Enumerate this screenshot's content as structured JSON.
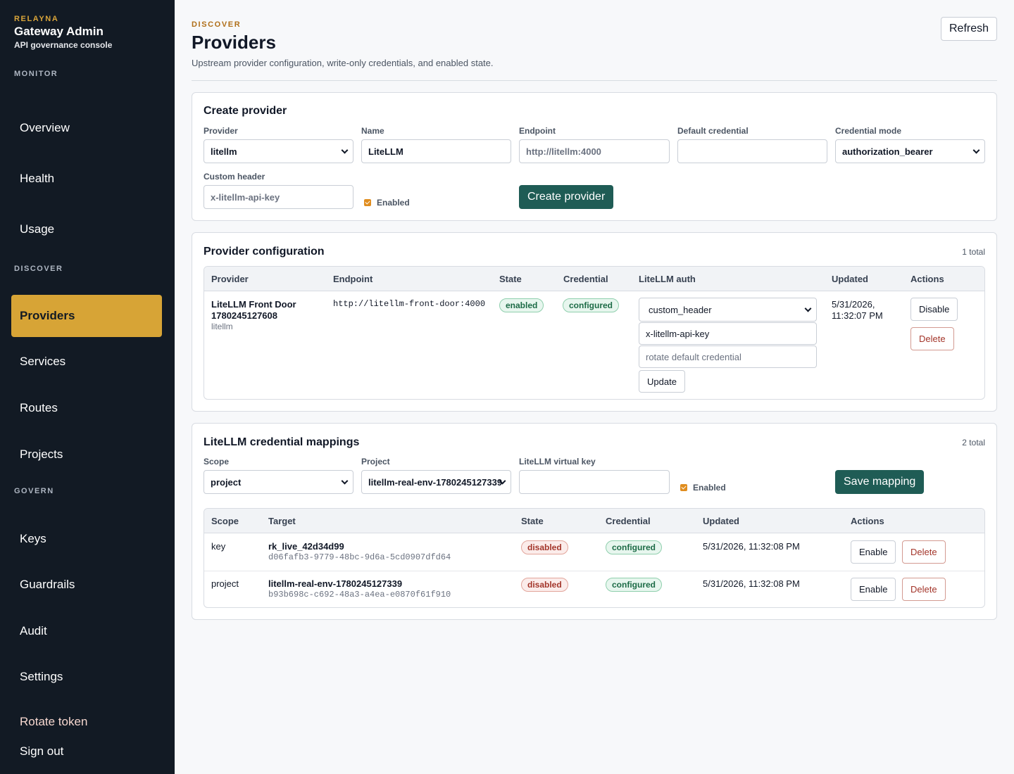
{
  "sidebar": {
    "brand": {
      "kicker": "RELAYNA",
      "title": "Gateway Admin",
      "subtitle": "API governance console"
    },
    "sections": {
      "monitor": "MONITOR",
      "discover": "DISCOVER",
      "govern": "GOVERN"
    },
    "items": {
      "overview": "Overview",
      "health": "Health",
      "usage": "Usage",
      "providers": "Providers",
      "services": "Services",
      "routes": "Routes",
      "projects": "Projects",
      "keys": "Keys",
      "guardrails": "Guardrails",
      "audit": "Audit",
      "settings": "Settings"
    },
    "active": "providers",
    "rotate_token": "Rotate token",
    "sign_out": "Sign out"
  },
  "header": {
    "kicker": "DISCOVER",
    "title": "Providers",
    "description": "Upstream provider configuration, write-only credentials, and enabled state.",
    "refresh_label": "Refresh"
  },
  "create": {
    "title": "Create provider",
    "labels": {
      "provider": "Provider",
      "name": "Name",
      "endpoint": "Endpoint",
      "default_credential": "Default credential",
      "credential_mode": "Credential mode",
      "custom_header": "Custom header"
    },
    "values": {
      "provider": "litellm",
      "name": "LiteLLM",
      "default_credential": "",
      "credential_mode": "authorization_bearer"
    },
    "placeholders": {
      "endpoint": "http://litellm:4000",
      "custom_header": "x-litellm-api-key"
    },
    "enabled_label": "Enabled",
    "enabled": true,
    "submit_label": "Create provider"
  },
  "config": {
    "title": "Provider configuration",
    "count": "1 total",
    "headers": {
      "provider": "Provider",
      "endpoint": "Endpoint",
      "state": "State",
      "credential": "Credential",
      "auth": "LiteLLM auth",
      "updated": "Updated",
      "actions": "Actions"
    },
    "row": {
      "name_line1": "LiteLLM Front Door",
      "name_line2": "1780245127608",
      "kind": "litellm",
      "endpoint": "http://litellm-front-door:4000",
      "state": "enabled",
      "credential": "configured",
      "auth_mode": "custom_header",
      "auth_header": "x-litellm-api-key",
      "rotate_placeholder": "rotate default credential",
      "update_label": "Update",
      "updated_line1": "5/31/2026,",
      "updated_line2": "11:32:07 PM",
      "disable_label": "Disable",
      "delete_label": "Delete"
    }
  },
  "mappings": {
    "title": "LiteLLM credential mappings",
    "count": "2 total",
    "labels": {
      "scope": "Scope",
      "project": "Project",
      "virtual_key": "LiteLLM virtual key"
    },
    "values": {
      "scope": "project",
      "project": "litellm-real-env-1780245127339",
      "virtual_key": ""
    },
    "enabled_label": "Enabled",
    "enabled": true,
    "save_label": "Save mapping",
    "headers": {
      "scope": "Scope",
      "target": "Target",
      "state": "State",
      "credential": "Credential",
      "updated": "Updated",
      "actions": "Actions"
    },
    "rows": [
      {
        "scope": "key",
        "target": "rk_live_42d34d99",
        "target_id": "d06fafb3-9779-48bc-9d6a-5cd0907dfd64",
        "state": "disabled",
        "credential": "configured",
        "updated": "5/31/2026, 11:32:08 PM",
        "enable_label": "Enable",
        "delete_label": "Delete"
      },
      {
        "scope": "project",
        "target": "litellm-real-env-1780245127339",
        "target_id": "b93b698c-c692-48a3-a4ea-e0870f61f910",
        "state": "disabled",
        "credential": "configured",
        "updated": "5/31/2026, 11:32:08 PM",
        "enable_label": "Enable",
        "delete_label": "Delete"
      }
    ]
  },
  "colors": {
    "sidebar_bg": "#121a24",
    "accent": "#d7a436",
    "primary": "#1f5c55",
    "success": "#1c6b46",
    "danger": "#a3352a"
  }
}
